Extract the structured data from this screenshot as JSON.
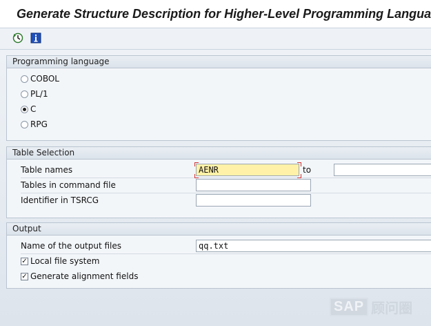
{
  "window": {
    "title": "Generate Structure Description for Higher-Level Programming Language"
  },
  "toolbar": {
    "execute_icon": "execute-clock-icon",
    "info_icon": "info-icon"
  },
  "programming_language": {
    "header": "Programming language",
    "options": [
      "COBOL",
      "PL/1",
      "C",
      "RPG"
    ],
    "selected": "C"
  },
  "table_selection": {
    "header": "Table Selection",
    "table_names_label": "Table names",
    "table_names_from": "AENR",
    "to_label": "to",
    "table_names_to": "",
    "tables_in_command_file_label": "Tables in command file",
    "tables_in_command_file_value": "",
    "identifier_label": "Identifier in TSRCG",
    "identifier_value": ""
  },
  "output": {
    "header": "Output",
    "output_files_label": "Name of the output files",
    "output_files_value": "qq.txt",
    "local_file_system_label": "Local file system",
    "local_file_system_checked": true,
    "alignment_fields_label": "Generate alignment fields",
    "alignment_fields_checked": true
  },
  "watermark": {
    "brand": "SAP",
    "cn_text": "顾问圈"
  },
  "colors": {
    "required_field": "#fff2a8",
    "required_mark": "#d23030",
    "background": "#dfe6ee"
  }
}
